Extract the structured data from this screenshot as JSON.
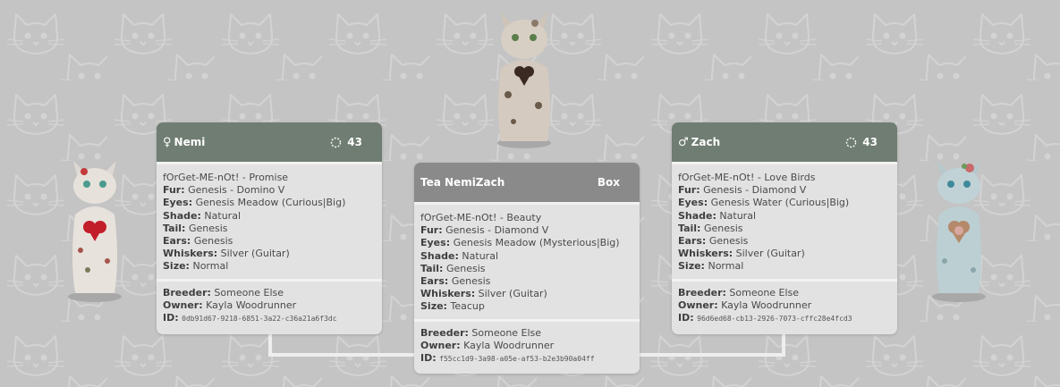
{
  "colors": {
    "background": "#c4c4c4",
    "parent_header": "#6f7d72",
    "child_header": "#8a8a8a",
    "card_body": "#e2e2e2",
    "connector": "#eeeeee"
  },
  "background_pattern": "cat-face-outline-icon",
  "mother": {
    "gender_icon": "female-icon",
    "gender_symbol": "♀",
    "name": "Nemi",
    "generation_icon": "dotted-circle-icon",
    "generation": "43",
    "title": "fOrGet-ME-nOt! - Promise",
    "traits": [
      {
        "label": "Fur:",
        "value": "Genesis - Domino V"
      },
      {
        "label": "Eyes:",
        "value": "Genesis Meadow (Curious|Big)"
      },
      {
        "label": "Shade:",
        "value": "Natural"
      },
      {
        "label": "Tail:",
        "value": "Genesis"
      },
      {
        "label": "Ears:",
        "value": "Genesis"
      },
      {
        "label": "Whiskers:",
        "value": "Silver (Guitar)"
      },
      {
        "label": "Size:",
        "value": "Normal"
      }
    ],
    "breeder_label": "Breeder:",
    "breeder": "Someone Else",
    "owner_label": "Owner:",
    "owner": "Kayla Woodrunner",
    "id_label": "ID:",
    "id": "0db91d67-9218-6851-3a22-c36a21a6f3dc"
  },
  "offspring": {
    "name": "Tea NemiZach",
    "status": "Box",
    "title": "fOrGet-ME-nOt! - Beauty",
    "traits": [
      {
        "label": "Fur:",
        "value": "Genesis - Diamond V"
      },
      {
        "label": "Eyes:",
        "value": "Genesis Meadow (Mysterious|Big)"
      },
      {
        "label": "Shade:",
        "value": "Natural"
      },
      {
        "label": "Tail:",
        "value": "Genesis"
      },
      {
        "label": "Ears:",
        "value": "Genesis"
      },
      {
        "label": "Whiskers:",
        "value": "Silver (Guitar)"
      },
      {
        "label": "Size:",
        "value": "Teacup"
      }
    ],
    "breeder_label": "Breeder:",
    "breeder": "Someone Else",
    "owner_label": "Owner:",
    "owner": "Kayla Woodrunner",
    "id_label": "ID:",
    "id": "f55cc1d9-3a98-a05e-af53-b2e3b90a04ff"
  },
  "father": {
    "gender_icon": "male-icon",
    "gender_symbol": "♂",
    "name": "Zach",
    "generation_icon": "dotted-circle-icon",
    "generation": "43",
    "title": "fOrGet-ME-nOt! - Love Birds",
    "traits": [
      {
        "label": "Fur:",
        "value": "Genesis - Diamond V"
      },
      {
        "label": "Eyes:",
        "value": "Genesis Water (Curious|Big)"
      },
      {
        "label": "Shade:",
        "value": "Natural"
      },
      {
        "label": "Tail:",
        "value": "Genesis"
      },
      {
        "label": "Ears:",
        "value": "Genesis"
      },
      {
        "label": "Whiskers:",
        "value": "Silver (Guitar)"
      },
      {
        "label": "Size:",
        "value": "Normal"
      }
    ],
    "breeder_label": "Breeder:",
    "breeder": "Someone Else",
    "owner_label": "Owner:",
    "owner": "Kayla Woodrunner",
    "id_label": "ID:",
    "id": "96d6ed68-cb13-2926-7073-cffc28e4fcd3"
  }
}
